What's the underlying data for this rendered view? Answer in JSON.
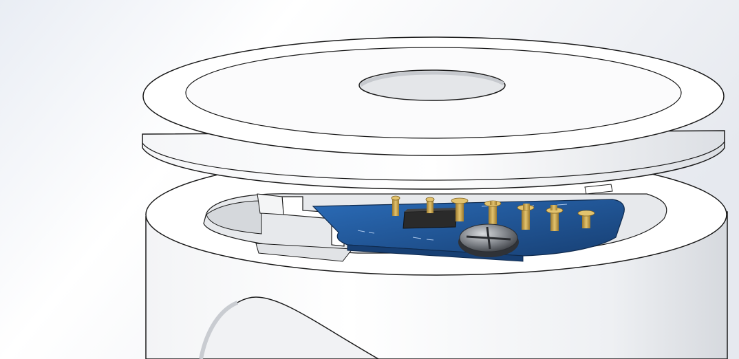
{
  "scene": {
    "subject": "cad-enclosure-render",
    "colors": {
      "background_top": "#ffffff",
      "background_bottom": "#e9edf4",
      "plastic": "#ffffff",
      "plastic_shade": "#d9dde3",
      "outline": "#1a1a1a",
      "pcb": "#1f5fa8",
      "pcb_dark": "#173f73",
      "pin_gold": "#c8a24a",
      "chip": "#2a2a2a",
      "screw": "#6b6e73"
    },
    "icons": {
      "lid": "lid-shape",
      "base": "cylinder-base-shape",
      "board": "pcb-shape",
      "screw": "screw-head-shape"
    }
  }
}
